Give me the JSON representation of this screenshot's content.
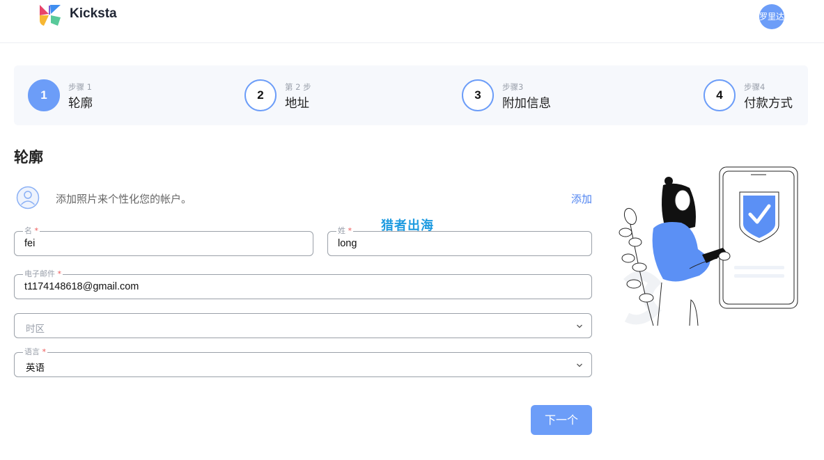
{
  "brand": {
    "name": "Kicksta"
  },
  "user": {
    "avatar_text": "罗里达"
  },
  "steps": [
    {
      "sub": "步骤 1",
      "title": "轮廓",
      "number": "1",
      "active": true
    },
    {
      "sub": "第 2 步",
      "title": "地址",
      "number": "2",
      "active": false
    },
    {
      "sub": "步骤3",
      "title": "附加信息",
      "number": "3",
      "active": false
    },
    {
      "sub": "步骤4",
      "title": "付款方式",
      "number": "4",
      "active": false
    }
  ],
  "section": {
    "title": "轮廓"
  },
  "photo": {
    "text": "添加照片来个性化您的帐户。",
    "add_label": "添加"
  },
  "watermark": "猎者出海",
  "form": {
    "first_name": {
      "label": "名",
      "required": "*",
      "value": "fei"
    },
    "last_name": {
      "label": "姓",
      "required": "*",
      "value": "long"
    },
    "email": {
      "label": "电子邮件",
      "required": "*",
      "value": "t1174148618@gmail.com"
    },
    "timezone": {
      "placeholder": "时区"
    },
    "language": {
      "label": "语言",
      "required": "*",
      "value": "英语"
    }
  },
  "next_button": "下一个",
  "colors": {
    "accent": "#6c9df8",
    "link": "#4f83f0",
    "stepper_bg": "#f6f8fc",
    "watermark": "#1e9be0"
  },
  "icons": [
    "logo-icon",
    "user-icon",
    "chevron-down-icon",
    "shield-check-icon"
  ]
}
